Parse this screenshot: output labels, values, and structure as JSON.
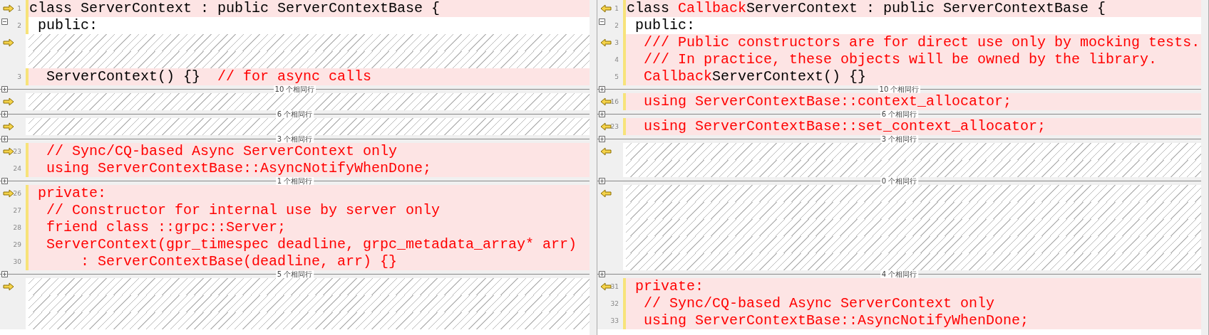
{
  "panes": [
    {
      "rows": [
        {
          "kind": "line",
          "number": "1",
          "marker": true,
          "toggle": false,
          "changed": true,
          "segments": [
            {
              "text": "class ServerContext : public ServerContextBase {",
              "differs": false
            }
          ]
        },
        {
          "kind": "line",
          "number": "2",
          "marker": false,
          "toggle": true,
          "changed": false,
          "segments": [
            {
              "text": " public:",
              "differs": false
            }
          ]
        },
        {
          "kind": "missing",
          "marker": true
        },
        {
          "kind": "missing",
          "marker": false
        },
        {
          "kind": "line",
          "number": "3",
          "marker": false,
          "toggle": false,
          "changed": true,
          "segments": [
            {
              "text": "  ServerContext() {}  ",
              "differs": false
            },
            {
              "text": "// for async calls",
              "differs": true
            }
          ]
        },
        {
          "kind": "fold",
          "label": "10 个相同行"
        },
        {
          "kind": "missing",
          "marker": true
        },
        {
          "kind": "fold",
          "label": "6 个相同行"
        },
        {
          "kind": "missing",
          "marker": true
        },
        {
          "kind": "fold",
          "label": "3 个相同行"
        },
        {
          "kind": "line",
          "number": "23",
          "marker": true,
          "toggle": false,
          "changed": true,
          "segments": [
            {
              "text": "  // Sync/CQ-based Async ServerContext only",
              "differs": true
            }
          ]
        },
        {
          "kind": "line",
          "number": "24",
          "marker": false,
          "toggle": false,
          "changed": true,
          "segments": [
            {
              "text": "  using ServerContextBase::AsyncNotifyWhenDone;",
              "differs": true
            }
          ]
        },
        {
          "kind": "fold",
          "label": "1 个相同行"
        },
        {
          "kind": "line",
          "number": "26",
          "marker": true,
          "toggle": false,
          "changed": true,
          "segments": [
            {
              "text": " private:",
              "differs": true
            }
          ]
        },
        {
          "kind": "line",
          "number": "27",
          "marker": false,
          "toggle": false,
          "changed": true,
          "segments": [
            {
              "text": "  // Constructor for internal use by server only",
              "differs": true
            }
          ]
        },
        {
          "kind": "line",
          "number": "28",
          "marker": false,
          "toggle": false,
          "changed": true,
          "segments": [
            {
              "text": "  friend class ::grpc::Server;",
              "differs": true
            }
          ]
        },
        {
          "kind": "line",
          "number": "29",
          "marker": false,
          "toggle": false,
          "changed": true,
          "segments": [
            {
              "text": "  ServerContext(gpr_timespec deadline, grpc_metadata_array* arr)",
              "differs": true
            }
          ]
        },
        {
          "kind": "line",
          "number": "30",
          "marker": false,
          "toggle": false,
          "changed": true,
          "segments": [
            {
              "text": "      : ServerContextBase(deadline, arr) {}",
              "differs": true
            }
          ]
        },
        {
          "kind": "fold",
          "label": "5 个相同行"
        },
        {
          "kind": "missing",
          "marker": true
        },
        {
          "kind": "missing",
          "marker": false
        },
        {
          "kind": "missing",
          "marker": false
        }
      ]
    },
    {
      "rows": [
        {
          "kind": "line",
          "number": "1",
          "marker": true,
          "toggle": false,
          "changed": true,
          "segments": [
            {
              "text": "class ",
              "differs": false
            },
            {
              "text": "Callback",
              "differs": true
            },
            {
              "text": "ServerContext : public ServerContextBase {",
              "differs": false
            }
          ]
        },
        {
          "kind": "line",
          "number": "2",
          "marker": false,
          "toggle": true,
          "changed": false,
          "segments": [
            {
              "text": " public:",
              "differs": false
            }
          ]
        },
        {
          "kind": "line",
          "number": "3",
          "marker": true,
          "toggle": false,
          "changed": true,
          "segments": [
            {
              "text": "  /// Public constructors are for direct use only by mocking tests.",
              "differs": true
            }
          ]
        },
        {
          "kind": "line",
          "number": "4",
          "marker": false,
          "toggle": false,
          "changed": true,
          "segments": [
            {
              "text": "  /// In practice, these objects will be owned by the library.",
              "differs": true
            }
          ]
        },
        {
          "kind": "line",
          "number": "5",
          "marker": false,
          "toggle": false,
          "changed": true,
          "segments": [
            {
              "text": "  Callback",
              "differs": true
            },
            {
              "text": "ServerContext() {}",
              "differs": false
            }
          ]
        },
        {
          "kind": "fold",
          "label": "10 个相同行"
        },
        {
          "kind": "line",
          "number": "16",
          "marker": true,
          "toggle": false,
          "changed": true,
          "segments": [
            {
              "text": "  using ServerContextBase::context_allocator;",
              "differs": true
            }
          ]
        },
        {
          "kind": "fold",
          "label": "6 个相同行"
        },
        {
          "kind": "line",
          "number": "23",
          "marker": true,
          "toggle": false,
          "changed": true,
          "segments": [
            {
              "text": "  using ServerContextBase::set_context_allocator;",
              "differs": true
            }
          ]
        },
        {
          "kind": "fold",
          "label": "3 个相同行"
        },
        {
          "kind": "missing",
          "marker": true
        },
        {
          "kind": "missing",
          "marker": false
        },
        {
          "kind": "fold",
          "label": "0 个相同行"
        },
        {
          "kind": "missing",
          "marker": true
        },
        {
          "kind": "missing",
          "marker": false
        },
        {
          "kind": "missing",
          "marker": false
        },
        {
          "kind": "missing",
          "marker": false
        },
        {
          "kind": "missing",
          "marker": false
        },
        {
          "kind": "fold",
          "label": "4 个相同行"
        },
        {
          "kind": "line",
          "number": "31",
          "marker": true,
          "toggle": false,
          "changed": true,
          "segments": [
            {
              "text": " private:",
              "differs": true
            }
          ]
        },
        {
          "kind": "line",
          "number": "32",
          "marker": false,
          "toggle": false,
          "changed": true,
          "segments": [
            {
              "text": "  // Sync/CQ-based Async ServerContext only",
              "differs": true
            }
          ]
        },
        {
          "kind": "line",
          "number": "33",
          "marker": false,
          "toggle": false,
          "changed": true,
          "segments": [
            {
              "text": "  using ServerContextBase::AsyncNotifyWhenDone;",
              "differs": true
            }
          ]
        }
      ]
    }
  ]
}
